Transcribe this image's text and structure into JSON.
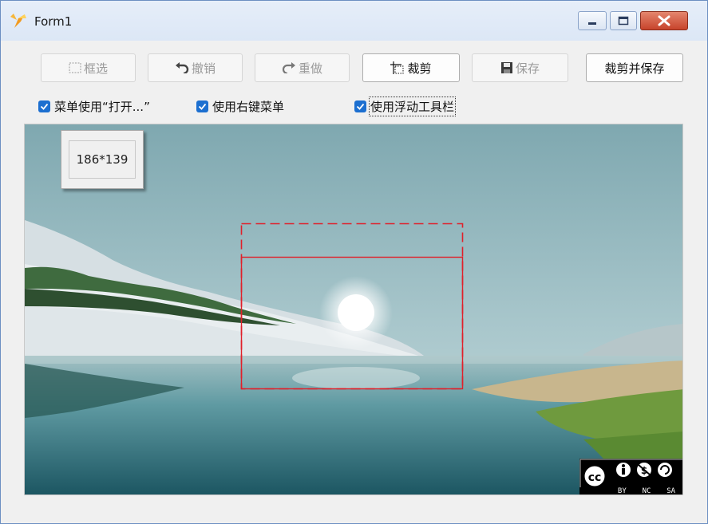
{
  "window": {
    "title": "Form1"
  },
  "toolbar": {
    "select_label": "框选",
    "undo_label": "撤销",
    "redo_label": "重做",
    "crop_label": "裁剪",
    "save_label": "保存",
    "crop_save_label": "裁剪并保存"
  },
  "options": {
    "menu_open": {
      "label": "菜单使用“打开...”",
      "checked": true
    },
    "right_click_menu": {
      "label": "使用右键菜单",
      "checked": true
    },
    "floating_toolbar": {
      "label": "使用浮动工具栏",
      "checked": true
    }
  },
  "selection": {
    "size_text": "186*139"
  },
  "license": {
    "badge": "cc-by-nc-sa",
    "text": [
      "BY",
      "NC",
      "SA"
    ]
  },
  "colors": {
    "accent": "#1c6fd0",
    "selection": "#e0202a",
    "titlebar": "#dce7f6"
  }
}
